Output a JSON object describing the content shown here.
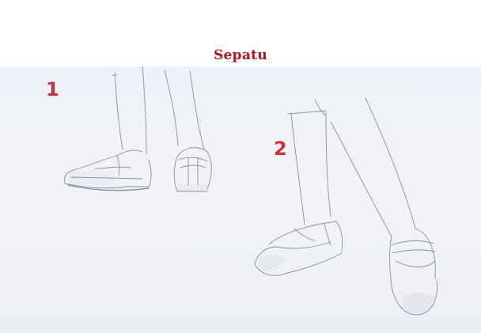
{
  "title": "Sepatu",
  "labels": {
    "step_1": "1",
    "step_2": "2"
  },
  "colors": {
    "title": "#b5121b",
    "labels": "#c9333d",
    "paper": "#eef1f7",
    "pencil": "#8a8f9e"
  }
}
